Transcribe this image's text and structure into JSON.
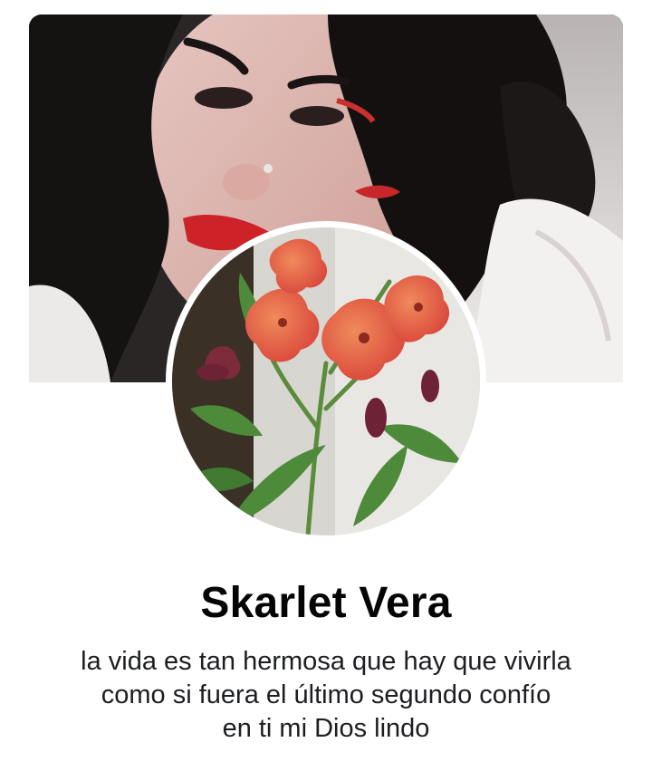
{
  "profile": {
    "name": "Skarlet Vera",
    "bio_lines": [
      "la vida es tan hermosa que hay que vivirla",
      "como si fuera el último segundo confío",
      "en ti mi Dios lindo"
    ]
  },
  "images": {
    "cover": "cover-photo",
    "avatar": "profile-photo-flowers"
  },
  "colors": {
    "name_text": "#050505",
    "bio_text": "#1c1e21",
    "background": "#ffffff",
    "flower": "#e0533a",
    "leaf": "#4d8a3a"
  }
}
